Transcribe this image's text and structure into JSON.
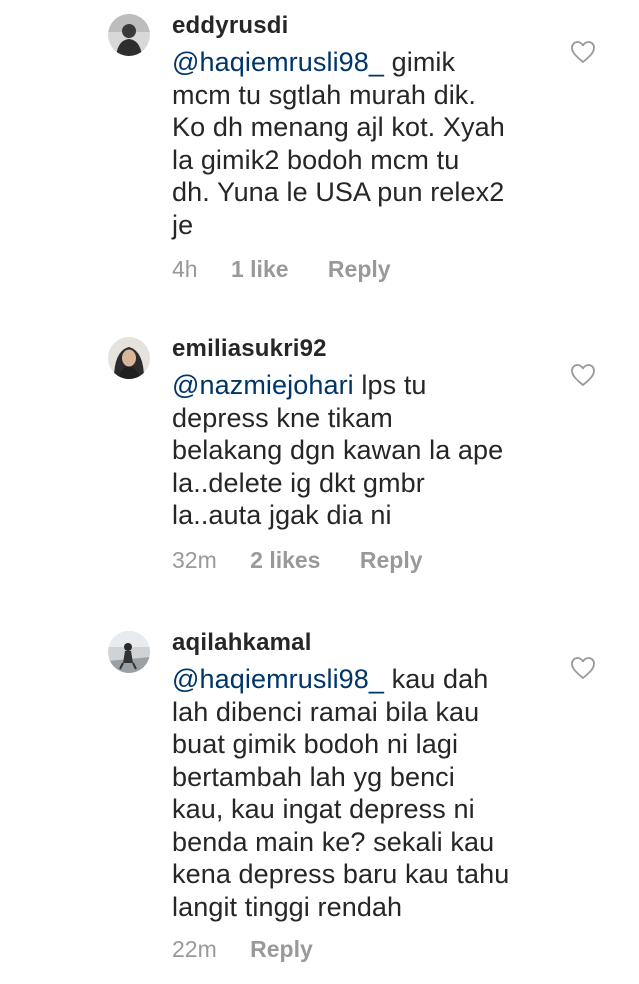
{
  "comments": [
    {
      "username": "eddyrusdi",
      "mention": "@haqiemrusli98_",
      "lines": [
        " gimik",
        "mcm tu sgtlah murah dik.",
        "Ko dh menang ajl kot. Xyah",
        "la gimik2 bodoh mcm tu",
        "dh. Yuna le USA pun relex2",
        "je"
      ],
      "time": "4h",
      "likes": "1 like",
      "reply": "Reply",
      "avatar_color": "#3a3a3a"
    },
    {
      "username": "emiliasukri92",
      "mention": "@nazmiejohari",
      "lines": [
        " lps tu",
        "depress kne tikam",
        "belakang dgn kawan la ape",
        "la..delete ig dkt gmbr",
        "la..auta jgak dia ni"
      ],
      "time": "32m",
      "likes": "2 likes",
      "reply": "Reply",
      "avatar_color": "#2b2b2b"
    },
    {
      "username": "aqilahkamal",
      "mention": "@haqiemrusli98_",
      "lines": [
        " kau dah",
        "lah dibenci ramai bila kau",
        "buat gimik bodoh ni lagi",
        "bertambah lah yg benci",
        "kau, kau ingat depress ni",
        "benda main ke? sekali kau",
        "kena depress baru kau tahu",
        "langit tinggi rendah"
      ],
      "time": "22m",
      "likes": "",
      "reply": "Reply",
      "avatar_color": "#8c8c8c"
    }
  ],
  "colors": {
    "text": "#262626",
    "mention": "#003569",
    "meta": "#999999",
    "heart": "#999999"
  },
  "icons": {
    "like": "heart-outline-icon"
  }
}
